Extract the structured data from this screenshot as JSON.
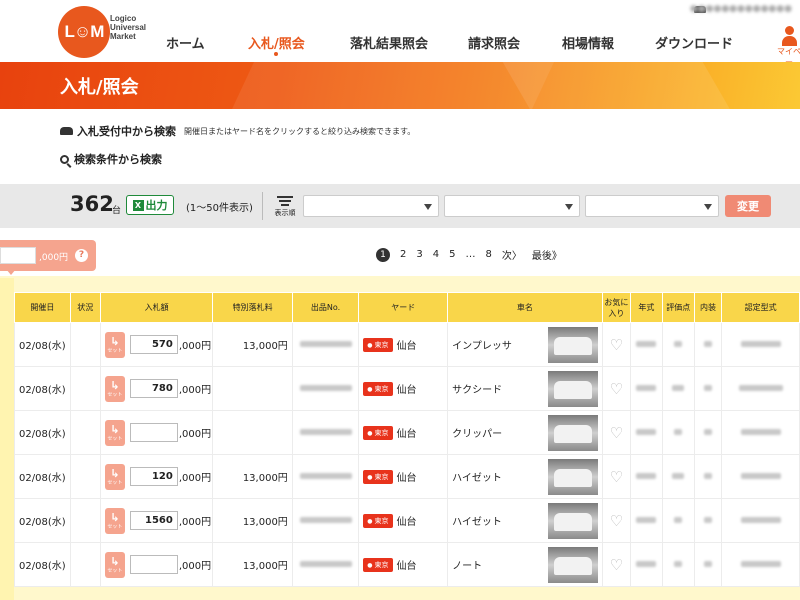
{
  "brand": {
    "logo_text": "L☺M",
    "name_lines": [
      "Logico",
      "Universal",
      "Market"
    ]
  },
  "nav": {
    "items": [
      "ホーム",
      "入札/照会",
      "落札結果照会",
      "請求照会",
      "相場情報",
      "ダウンロード"
    ],
    "active": "入札/照会",
    "mypage_label": "マイペー"
  },
  "page": {
    "title": "入札/照会"
  },
  "search": {
    "accepting_label": "入札受付中から検索",
    "accepting_hint": "開催日またはヤード名をクリックすると絞り込み検索できます。",
    "conditions_label": "検索条件から検索"
  },
  "toolbar": {
    "count": "362",
    "count_unit": "台",
    "excel_label": "出力",
    "excel_icon": "X",
    "range": "(1〜50件表示)",
    "sort_label": "表示順",
    "select_values": [
      "",
      "",
      ""
    ],
    "change_label": "変更"
  },
  "filter": {
    "suffix": ",000円",
    "help": "?"
  },
  "pagination": {
    "pages": [
      "1",
      "2",
      "3",
      "4",
      "5",
      "…",
      "8"
    ],
    "current": "1",
    "next": "次〉",
    "last": "最後》"
  },
  "table": {
    "headers": [
      "開催日",
      "状況",
      "入札額",
      "特別落札料",
      "出品No.",
      "ヤード",
      "車名",
      "お気に入り",
      "年式",
      "評価点",
      "内装",
      "認定型式"
    ],
    "set_label": "セット",
    "bid_suffix": ",000円",
    "rows": [
      {
        "date": "02/08(水)",
        "bid": "570",
        "fee": "13,000円",
        "yard": "東京",
        "city": "仙台",
        "car": "インプレッサ"
      },
      {
        "date": "02/08(水)",
        "bid": "780",
        "fee": "",
        "yard": "東京",
        "city": "仙台",
        "car": "サクシード"
      },
      {
        "date": "02/08(水)",
        "bid": "",
        "fee": "",
        "yard": "東京",
        "city": "仙台",
        "car": "クリッパー"
      },
      {
        "date": "02/08(水)",
        "bid": "120",
        "fee": "13,000円",
        "yard": "東京",
        "city": "仙台",
        "car": "ハイゼット"
      },
      {
        "date": "02/08(水)",
        "bid": "1560",
        "fee": "13,000円",
        "yard": "東京",
        "city": "仙台",
        "car": "ハイゼット"
      },
      {
        "date": "02/08(水)",
        "bid": "",
        "fee": "13,000円",
        "yard": "東京",
        "city": "仙台",
        "car": "ノート"
      }
    ]
  },
  "colors": {
    "accent": "#e8581e",
    "header_yellow": "#f9d64a",
    "badge_red": "#e8331c",
    "set_salmon": "#f5a48e"
  }
}
